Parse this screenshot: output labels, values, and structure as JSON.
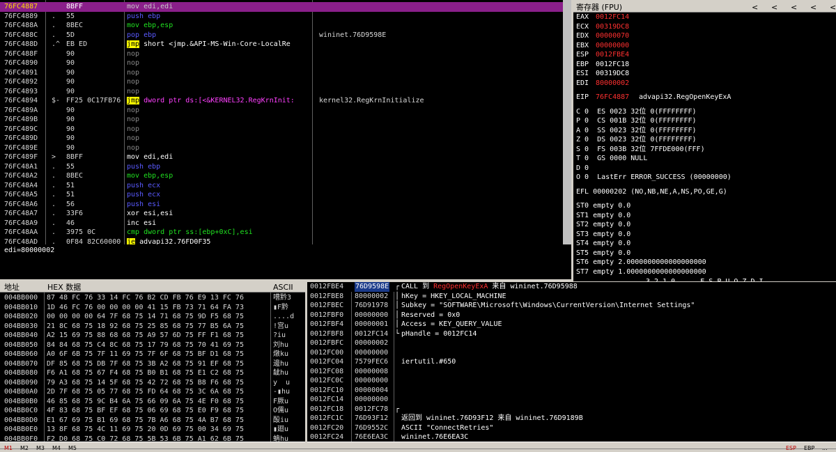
{
  "disasm": {
    "rows": [
      {
        "addr": "76FC4887",
        "mark": "",
        "bytes": "8BFF",
        "asm": [
          {
            "t": "mov edi,edi",
            "c": "dim"
          }
        ],
        "comment": "",
        "selected": true
      },
      {
        "addr": "76FC4889",
        "mark": ".",
        "bytes": "55",
        "asm": [
          {
            "t": "push ebp",
            "c": "blue"
          }
        ],
        "comment": ""
      },
      {
        "addr": "76FC488A",
        "mark": ".",
        "bytes": "8BEC",
        "asm": [
          {
            "t": "mov ebp,esp",
            "c": "green"
          }
        ],
        "comment": ""
      },
      {
        "addr": "76FC488C",
        "mark": ".",
        "bytes": "5D",
        "asm": [
          {
            "t": "pop ebp",
            "c": "blue"
          }
        ],
        "comment": "wininet.76D9598E"
      },
      {
        "addr": "76FC488D",
        "mark": ".^",
        "bytes": "EB ED",
        "asm": [
          {
            "t": "jmp",
            "c": "jmp"
          },
          {
            "t": " short <jmp.&API-MS-Win-Core-LocalRe",
            "c": "white"
          }
        ],
        "comment": ""
      },
      {
        "addr": "76FC488F",
        "mark": "",
        "bytes": "90",
        "asm": [
          {
            "t": "nop",
            "c": "dim"
          }
        ],
        "comment": ""
      },
      {
        "addr": "76FC4890",
        "mark": "",
        "bytes": "90",
        "asm": [
          {
            "t": "nop",
            "c": "dim"
          }
        ],
        "comment": ""
      },
      {
        "addr": "76FC4891",
        "mark": "",
        "bytes": "90",
        "asm": [
          {
            "t": "nop",
            "c": "dim"
          }
        ],
        "comment": ""
      },
      {
        "addr": "76FC4892",
        "mark": "",
        "bytes": "90",
        "asm": [
          {
            "t": "nop",
            "c": "dim"
          }
        ],
        "comment": ""
      },
      {
        "addr": "76FC4893",
        "mark": "",
        "bytes": "90",
        "asm": [
          {
            "t": "nop",
            "c": "dim"
          }
        ],
        "comment": ""
      },
      {
        "addr": "76FC4894",
        "mark": "$-",
        "bytes": "FF25 0C17FB76",
        "asm": [
          {
            "t": "jmp",
            "c": "jmp"
          },
          {
            "t": " dword ptr ds:[<&KERNEL32.RegKrnInit:",
            "c": "mag"
          }
        ],
        "comment": "kernel32.RegKrnInitialize"
      },
      {
        "addr": "76FC489A",
        "mark": "",
        "bytes": "90",
        "asm": [
          {
            "t": "nop",
            "c": "dim"
          }
        ],
        "comment": ""
      },
      {
        "addr": "76FC489B",
        "mark": "",
        "bytes": "90",
        "asm": [
          {
            "t": "nop",
            "c": "dim"
          }
        ],
        "comment": ""
      },
      {
        "addr": "76FC489C",
        "mark": "",
        "bytes": "90",
        "asm": [
          {
            "t": "nop",
            "c": "dim"
          }
        ],
        "comment": ""
      },
      {
        "addr": "76FC489D",
        "mark": "",
        "bytes": "90",
        "asm": [
          {
            "t": "nop",
            "c": "dim"
          }
        ],
        "comment": ""
      },
      {
        "addr": "76FC489E",
        "mark": "",
        "bytes": "90",
        "asm": [
          {
            "t": "nop",
            "c": "dim"
          }
        ],
        "comment": ""
      },
      {
        "addr": "76FC489F",
        "mark": ">",
        "bytes": "8BFF",
        "asm": [
          {
            "t": "mov edi,edi",
            "c": "white"
          }
        ],
        "comment": ""
      },
      {
        "addr": "76FC48A1",
        "mark": ".",
        "bytes": "55",
        "asm": [
          {
            "t": "push ebp",
            "c": "blue"
          }
        ],
        "comment": ""
      },
      {
        "addr": "76FC48A2",
        "mark": ".",
        "bytes": "8BEC",
        "asm": [
          {
            "t": "mov ebp,esp",
            "c": "green"
          }
        ],
        "comment": ""
      },
      {
        "addr": "76FC48A4",
        "mark": ".",
        "bytes": "51",
        "asm": [
          {
            "t": "push ecx",
            "c": "blue"
          }
        ],
        "comment": ""
      },
      {
        "addr": "76FC48A5",
        "mark": ".",
        "bytes": "51",
        "asm": [
          {
            "t": "push ecx",
            "c": "blue"
          }
        ],
        "comment": ""
      },
      {
        "addr": "76FC48A6",
        "mark": ".",
        "bytes": "56",
        "asm": [
          {
            "t": "push esi",
            "c": "blue"
          }
        ],
        "comment": ""
      },
      {
        "addr": "76FC48A7",
        "mark": ".",
        "bytes": "33F6",
        "asm": [
          {
            "t": "xor esi,esi",
            "c": "white"
          }
        ],
        "comment": ""
      },
      {
        "addr": "76FC48A9",
        "mark": ".",
        "bytes": "46",
        "asm": [
          {
            "t": "inc esi",
            "c": "white"
          }
        ],
        "comment": ""
      },
      {
        "addr": "76FC48AA",
        "mark": ".",
        "bytes": "3975 0C",
        "asm": [
          {
            "t": "cmp dword ptr ss:[ebp+0xC],esi",
            "c": "green"
          }
        ],
        "comment": ""
      },
      {
        "addr": "76FC48AD",
        "mark": ".",
        "bytes": "0F84 82C60000",
        "asm": [
          {
            "t": "je",
            "c": "jmp"
          },
          {
            "t": " advapi32.76FD0F35",
            "c": "white"
          }
        ],
        "comment": ""
      }
    ]
  },
  "info_line": "edi=80000002",
  "registers": {
    "title": "寄存器 (FPU)",
    "nav_arrows": [
      "<",
      "<",
      "<",
      "<",
      "<",
      "<"
    ],
    "gp": [
      {
        "name": "EAX",
        "val": "0012FC14",
        "extra": "",
        "red": true
      },
      {
        "name": "ECX",
        "val": "00319DC8",
        "extra": "",
        "red": true
      },
      {
        "name": "EDX",
        "val": "00000070",
        "extra": "",
        "red": true
      },
      {
        "name": "EBX",
        "val": "00000000",
        "extra": "",
        "red": true
      },
      {
        "name": "ESP",
        "val": "0012FBE4",
        "extra": "",
        "red": true
      },
      {
        "name": "EBP",
        "val": "0012FC18",
        "extra": "",
        "red": false
      },
      {
        "name": "ESI",
        "val": "00319DC8",
        "extra": "",
        "red": false
      },
      {
        "name": "EDI",
        "val": "80000002",
        "extra": "",
        "red": true
      }
    ],
    "eip": {
      "name": "EIP",
      "val": "76FC4887",
      "extra": "advapi32.RegOpenKeyExA"
    },
    "flags": [
      "C 0  ES 0023 32位 0(FFFFFFFF)",
      "P 0  CS 001B 32位 0(FFFFFFFF)",
      "A 0  SS 0023 32位 0(FFFFFFFF)",
      "Z 0  DS 0023 32位 0(FFFFFFFF)",
      "S 0  FS 003B 32位 7FFDE000(FFF)",
      "T 0  GS 0000 NULL",
      "D 0",
      "O 0  LastErr ERROR_SUCCESS (00000000)"
    ],
    "efl": "EFL 00000202 (NO,NB,NE,A,NS,PO,GE,G)",
    "fpu": [
      "ST0 empty 0.0",
      "ST1 empty 0.0",
      "ST2 empty 0.0",
      "ST3 empty 0.0",
      "ST4 empty 0.0",
      "ST5 empty 0.0",
      "ST6 empty 2.0000000000000000000",
      "ST7 empty 1.0000000000000000000"
    ],
    "fpu_tail": "3 2 1 0      E S P U O Z D I"
  },
  "dump": {
    "header_addr": "地址",
    "header_hex": "HEX 数据",
    "header_ascii": "ASCII",
    "rows": [
      {
        "addr": "004BB000",
        "hex": "87 48 FC 76 33 14 FC 76 B2 CD FB 76 E9 13 FC 76",
        "ascii": "嘈黔3"
      },
      {
        "addr": "004BB010",
        "hex": "1D 46 FC 76 00 00 00 00 41 15 FB 73 71 64 FA 73",
        "ascii": "▮F黔"
      },
      {
        "addr": "004BB020",
        "hex": "00 00 00 00 64 7F 68 75 14 71 68 75 9D F5 68 75",
        "ascii": "....d"
      },
      {
        "addr": "004BB030",
        "hex": "21 8C 68 75 18 92 68 75 25 85 68 75 77 B5 6A 75",
        "ascii": "!宫u"
      },
      {
        "addr": "004BB040",
        "hex": "A2 15 69 75 88 68 68 75 A9 57 6D 75 FF F1 68 75",
        "ascii": "?iu"
      },
      {
        "addr": "004BB050",
        "hex": "84 84 68 75 C4 8C 68 75 17 79 68 75 70 41 69 75",
        "ascii": "刘hu"
      },
      {
        "addr": "004BB060",
        "hex": "A0 6F 6B 75 7F 11 69 75 7F 6F 68 75 BF D1 68 75",
        "ascii": "燉ku"
      },
      {
        "addr": "004BB070",
        "hex": "DF 85 68 75 DB 7F 68 75 3B A2 68 75 91 EF 68 75",
        "ascii": "邊hu"
      },
      {
        "addr": "004BB080",
        "hex": "F6 A1 68 75 67 F4 68 75 B0 B1 68 75 E1 C2 68 75",
        "ascii": "龇hu"
      },
      {
        "addr": "004BB090",
        "hex": "79 A3 68 75 14 5F 68 75 42 72 68 75 B8 F6 68 75",
        "ascii": "y  u"
      },
      {
        "addr": "004BB0A0",
        "hex": "2D 7F 68 75 05 77 68 75 FD 64 68 75 3C 6A 68 75",
        "ascii": "-▮hu"
      },
      {
        "addr": "004BB0B0",
        "hex": "46 85 68 75 9C B4 6A 75 66 09 6A 75 4E F0 68 75",
        "ascii": "F厥u"
      },
      {
        "addr": "004BB0C0",
        "hex": "4F 83 68 75 BF EF 68 75 06 69 68 75 E0 F9 68 75",
        "ascii": "O儒u"
      },
      {
        "addr": "004BB0D0",
        "hex": "E1 67 69 75 B1 69 68 75 7B A6 68 75 4A B7 68 75",
        "ascii": "酘iu"
      },
      {
        "addr": "004BB0E0",
        "hex": "13 8F 68 75 4C 11 69 75 20 0D 69 75 00 34 69 75",
        "ascii": "▮廻u"
      },
      {
        "addr": "004BB0F0",
        "hex": "F2 D0 68 75 C0 72 68 75 5B 53 6B 75 A1 62 6B 75",
        "ascii": "蚺hu"
      }
    ]
  },
  "stack": {
    "rows": [
      {
        "addr": "0012FBE4",
        "val": "76D9598E",
        "bracket": "┌",
        "parts": [
          {
            "t": "CALL 到 ",
            "c": "white"
          },
          {
            "t": "RegOpenKeyExA",
            "c": "red"
          },
          {
            "t": " 来自 wininet.76D95988",
            "c": "white"
          }
        ],
        "top": true
      },
      {
        "addr": "0012FBE8",
        "val": "80000002",
        "bracket": "│",
        "parts": [
          {
            "t": "hKey = HKEY_LOCAL_MACHINE",
            "c": "white"
          }
        ]
      },
      {
        "addr": "0012FBEC",
        "val": "76D91978",
        "bracket": "│",
        "parts": [
          {
            "t": "Subkey = \"SOFTWARE\\Microsoft\\Windows\\CurrentVersion\\Internet Settings\"",
            "c": "white"
          }
        ]
      },
      {
        "addr": "0012FBF0",
        "val": "00000000",
        "bracket": "│",
        "parts": [
          {
            "t": "Reserved = 0x0",
            "c": "white"
          }
        ]
      },
      {
        "addr": "0012FBF4",
        "val": "00000001",
        "bracket": "│",
        "parts": [
          {
            "t": "Access = KEY_QUERY_VALUE",
            "c": "white"
          }
        ]
      },
      {
        "addr": "0012FBF8",
        "val": "0012FC14",
        "bracket": "└",
        "parts": [
          {
            "t": "pHandle = 0012FC14",
            "c": "white"
          }
        ]
      },
      {
        "addr": "0012FBFC",
        "val": "00000002",
        "bracket": "",
        "parts": []
      },
      {
        "addr": "0012FC00",
        "val": "00000000",
        "bracket": "",
        "parts": []
      },
      {
        "addr": "0012FC04",
        "val": "7579FEC6",
        "bracket": "",
        "parts": [
          {
            "t": "iertutil.#650",
            "c": "white"
          }
        ]
      },
      {
        "addr": "0012FC08",
        "val": "00000008",
        "bracket": "",
        "parts": []
      },
      {
        "addr": "0012FC0C",
        "val": "00000000",
        "bracket": "",
        "parts": []
      },
      {
        "addr": "0012FC10",
        "val": "00000004",
        "bracket": "",
        "parts": []
      },
      {
        "addr": "0012FC14",
        "val": "00000000",
        "bracket": "",
        "parts": []
      },
      {
        "addr": "0012FC18",
        "val": "0012FC78",
        "bracket": "┌",
        "parts": []
      },
      {
        "addr": "0012FC1C",
        "val": "76D93F12",
        "bracket": "",
        "parts": [
          {
            "t": "返回到 wininet.76D93F12 来自 wininet.76D9189B",
            "c": "white"
          }
        ]
      },
      {
        "addr": "0012FC20",
        "val": "76D9552C",
        "bracket": "",
        "parts": [
          {
            "t": "ASCII \"ConnectRetries\"",
            "c": "white"
          }
        ]
      },
      {
        "addr": "0012FC24",
        "val": "76E6EA3C",
        "bracket": "",
        "parts": [
          {
            "t": "wininet.76E6EA3C",
            "c": "white"
          }
        ]
      }
    ]
  },
  "statusbar": {
    "tabs": [
      "M1",
      "M2",
      "M3",
      "M4",
      "M5"
    ],
    "right": [
      "ESP",
      "EBP",
      "..."
    ]
  },
  "colors": {
    "selected_row": "#8a1f8a",
    "jmp_bg": "#ffff00",
    "reg_changed": "#ff3030",
    "push_pop": "#5a5aff",
    "mov": "#20e020",
    "ptr": "#ff40ff"
  }
}
